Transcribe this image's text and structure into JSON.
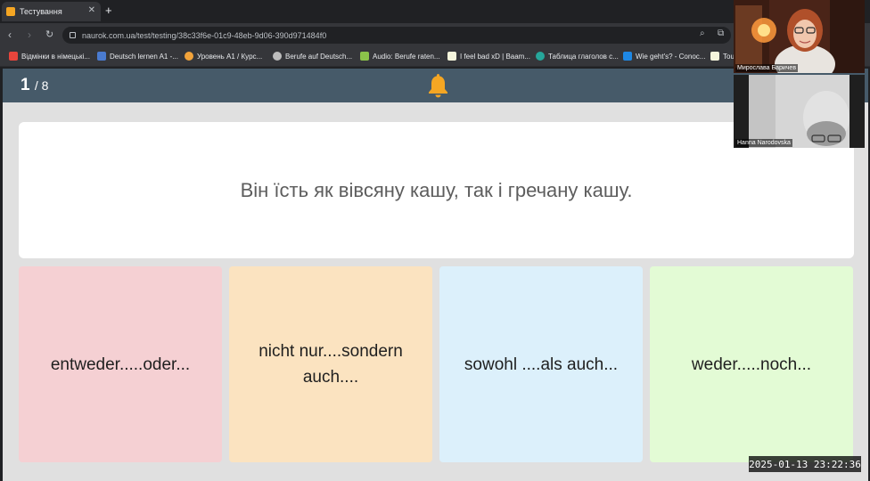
{
  "browser": {
    "tab_title": "Тестування",
    "url": "naurok.com.ua/test/testing/38c33f6e-01c9-48eb-9d06-390d971484f0",
    "bookmarks": [
      {
        "label": "Відмінки в німецькі...",
        "color": "#e8453c"
      },
      {
        "label": "Deutsch lernen A1 -...",
        "color": "#4a7bd0"
      },
      {
        "label": "Уровень А1 / Курс...",
        "color": "#f2a33a"
      },
      {
        "label": "Berufe auf Deutsch...",
        "color": "#bdbdbd"
      },
      {
        "label": "Audio: Berufe raten...",
        "color": "#8bc34a"
      },
      {
        "label": "I feel bad xD | Baam...",
        "color": "#f5f5dc"
      },
      {
        "label": "Таблица глаголов с...",
        "color": "#26a69a"
      },
      {
        "label": "Wie geht's? - Conoc...",
        "color": "#1e88e5"
      },
      {
        "label": "Tou",
        "color": "#f5f5dc"
      }
    ]
  },
  "quiz": {
    "current": "1",
    "total": "/ 8",
    "question": "Він їсть як вівсяну кашу, так і гречану кашу.",
    "answers": [
      {
        "label": "entweder.....oder...",
        "color": "#f5d0d3"
      },
      {
        "label": "nicht nur....sondern auch....",
        "color": "#fbe3c0"
      },
      {
        "label": "sowohl ....als auch...",
        "color": "#dcf0fb"
      },
      {
        "label": "weder.....noch...",
        "color": "#e3fbd5"
      }
    ],
    "header_color": "#465a69",
    "bell_color": "#f5a623"
  },
  "video_call": {
    "participants": [
      {
        "name": "Мирослава Баричев"
      },
      {
        "name": "Hanna Narodovska"
      }
    ]
  },
  "timestamp": "2025-01-13 23:22:36"
}
